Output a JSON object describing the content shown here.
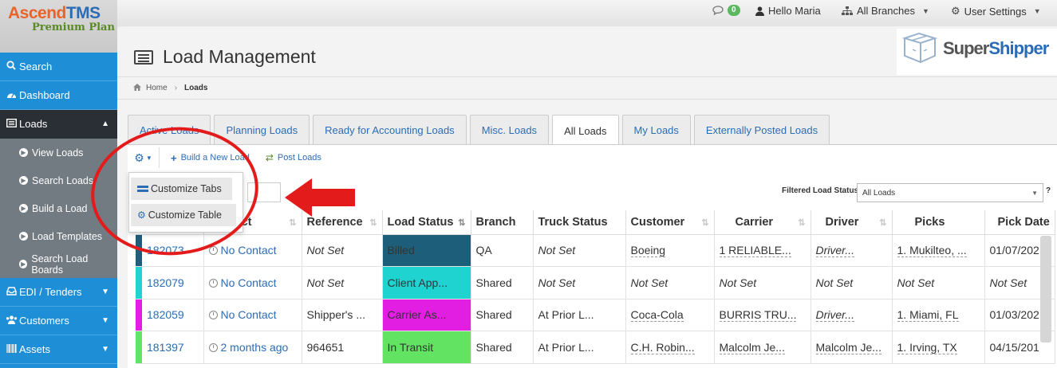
{
  "app": {
    "logo_part1": "Ascend",
    "logo_part2": "TMS",
    "plan": "Premium Plan"
  },
  "topbar": {
    "messages_count": "0",
    "greeting": "Hello Maria",
    "branches": "All Branches",
    "settings": "User Settings"
  },
  "brand": {
    "part1": "Super",
    "part2": "Shipper"
  },
  "sidebar": {
    "items": [
      {
        "label": "Search",
        "icon": "search-icon"
      },
      {
        "label": "Dashboard",
        "icon": "dashboard-icon"
      },
      {
        "label": "Loads",
        "icon": "list-icon",
        "active": true
      },
      {
        "label": "EDI / Tenders",
        "icon": "inbox-icon"
      },
      {
        "label": "Customers",
        "icon": "users-icon"
      },
      {
        "label": "Assets",
        "icon": "barcode-icon"
      }
    ],
    "sub_items": [
      {
        "label": "View Loads"
      },
      {
        "label": "Search Loads"
      },
      {
        "label": "Build a Load"
      },
      {
        "label": "Load Templates"
      },
      {
        "label": "Search Load Boards"
      }
    ]
  },
  "page": {
    "title": "Load Management"
  },
  "breadcrumb": {
    "home": "Home",
    "current": "Loads"
  },
  "tabs": [
    {
      "label": "Active Loads"
    },
    {
      "label": "Planning Loads"
    },
    {
      "label": "Ready for Accounting Loads"
    },
    {
      "label": "Misc. Loads"
    },
    {
      "label": "All Loads",
      "active": true
    },
    {
      "label": "My Loads"
    },
    {
      "label": "Externally Posted Loads"
    }
  ],
  "toolbar": {
    "build_new_load": "Build a New Load",
    "post_loads": "Post Loads"
  },
  "dropdown": {
    "customize_tabs": "Customize Tabs",
    "customize_table": "Customize Table"
  },
  "filter": {
    "label": "Filtered Load Status",
    "value": "All Loads",
    "help": "?"
  },
  "table": {
    "columns": [
      "",
      "Contact",
      "Reference",
      "Load Status",
      "Branch",
      "Truck Status",
      "Customer",
      "Carrier",
      "Driver",
      "Picks",
      "Pick Date"
    ],
    "rows": [
      {
        "color": "#1d5f7a",
        "id": "182073",
        "contact": "No Contact",
        "reference": "Not Set",
        "status": "Billed",
        "status_color": "#1d5f7a",
        "branch": "QA",
        "truck": "Not Set",
        "customer": "Boeing",
        "carrier": "1 RELIABLE...",
        "driver": "Driver...",
        "picks": "1. Mukilteo, ...",
        "pick_date": "01/07/202"
      },
      {
        "color": "#1fd3d0",
        "id": "182079",
        "contact": "No Contact",
        "reference": "Not Set",
        "status": "Client App...",
        "status_color": "#1fd3d0",
        "branch": "Shared",
        "truck": "Not Set",
        "customer": "Not Set",
        "carrier": "Not Set",
        "driver": "Not Set",
        "picks": "Not Set",
        "pick_date": "Not Set"
      },
      {
        "color": "#e31ee3",
        "id": "182059",
        "contact": "No Contact",
        "reference": "Shipper's ...",
        "status": "Carrier As...",
        "status_color": "#e31ee3",
        "branch": "Shared",
        "truck": "At Prior L...",
        "customer": "Coca-Cola",
        "carrier": "BURRIS TRU...",
        "driver": "Driver...",
        "picks": "1. Miami, FL",
        "pick_date": "01/03/202"
      },
      {
        "color": "#62e462",
        "id": "181397",
        "contact": "2 months ago",
        "reference": "964651",
        "status": "In Transit",
        "status_color": "#62e462",
        "branch": "Shared",
        "truck": "At Prior L...",
        "customer": "C.H. Robin...",
        "carrier": "Malcolm Je...",
        "driver": "Malcolm Je...",
        "picks": "1. Irving, TX",
        "pick_date": "04/15/201"
      }
    ]
  }
}
